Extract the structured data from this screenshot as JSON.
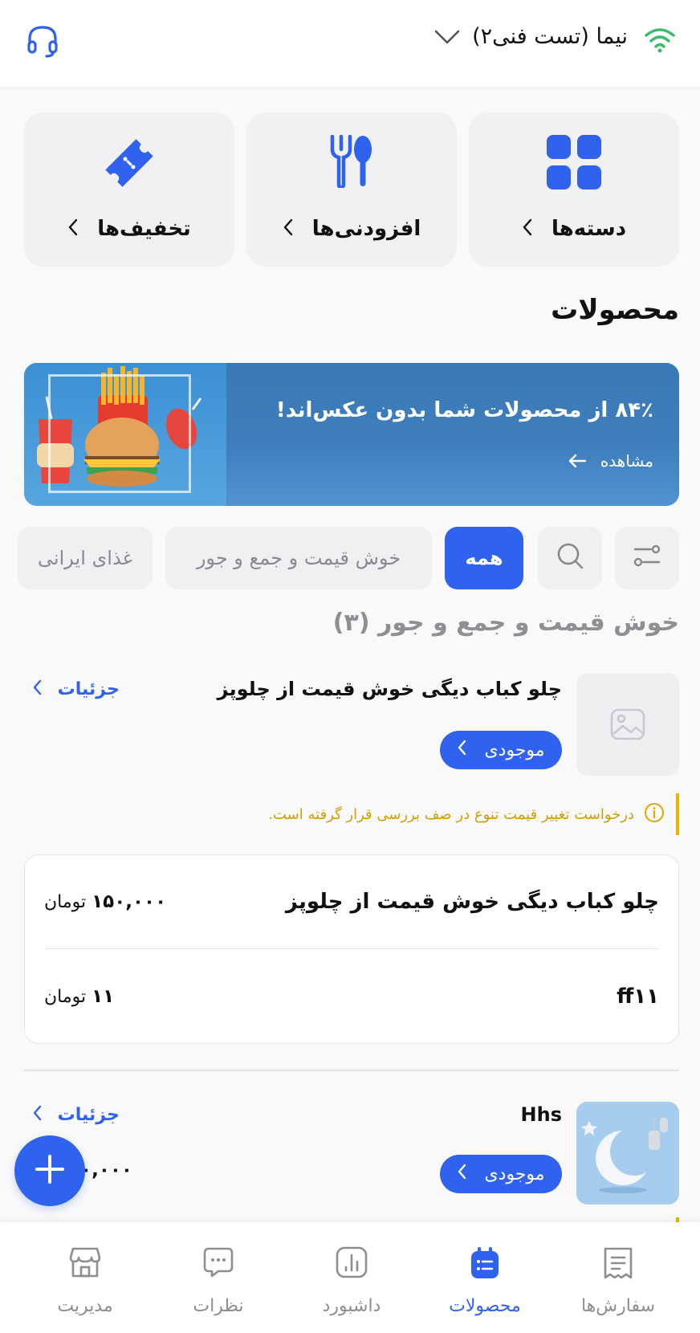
{
  "header": {
    "store_name": "نیما (تست فنی۲)"
  },
  "quick_cards": [
    {
      "label": "دسته‌ها"
    },
    {
      "label": "افزودنی‌ها"
    },
    {
      "label": "تخفیف‌ها"
    }
  ],
  "section_title": "محصولات",
  "banner": {
    "text": "۸۴٪ از محصولات شما بدون عکس‌اند!",
    "view_label": "مشاهده"
  },
  "filters": {
    "all_label": "همه",
    "chip_1": "خوش قیمت و جمع و جور",
    "chip_2": "غذای ایرانی"
  },
  "group_title": "خوش قیمت و جمع و جور (۳)",
  "products": [
    {
      "name": "چلو کباب دیگی خوش قیمت از چلوپز",
      "details_label": "جزئیات",
      "stock_label": "موجودی",
      "notice": "درخواست تغییر قیمت تنوع در صف بررسی قرار گرفته است.",
      "variants": [
        {
          "name": "چلو کباب دیگی خوش قیمت از چلوپز",
          "price": "۱۵۰,۰۰۰",
          "currency": "تومان"
        },
        {
          "name": "ff۱۱",
          "price": "۱۱",
          "currency": "تومان"
        }
      ]
    },
    {
      "name": "Hhs",
      "details_label": "جزئیات",
      "stock_label": "موجودی",
      "price_partial": "۰۰,۰۰۰"
    }
  ],
  "bottom_nav": [
    {
      "label": "سفارش‌ها",
      "icon": "receipt-icon"
    },
    {
      "label": "محصولات",
      "icon": "products-icon",
      "active": true
    },
    {
      "label": "داشبورد",
      "icon": "chart-icon"
    },
    {
      "label": "نظرات",
      "icon": "chat-icon"
    },
    {
      "label": "مدیریت",
      "icon": "store-icon"
    }
  ],
  "colors": {
    "accent": "#2f63ee",
    "warning": "#e8b400",
    "wifi": "#3dbb6e"
  }
}
